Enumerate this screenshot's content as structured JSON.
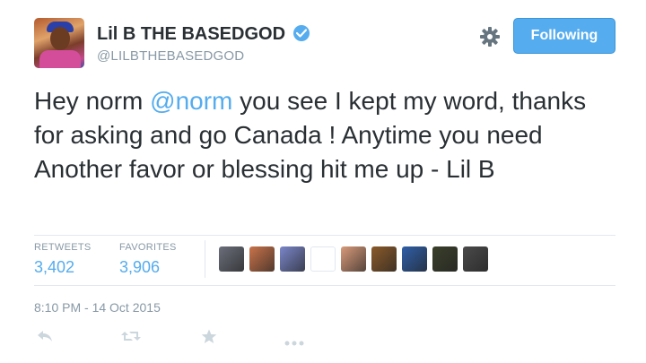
{
  "user": {
    "name": "Lil B THE BASEDGOD",
    "handle": "@LILBTHEBASEDGOD",
    "verified": true
  },
  "follow_button": {
    "label": "Following"
  },
  "tweet": {
    "text_before": "Hey norm ",
    "mention": "@norm",
    "text_after": " you see I kept my word, thanks for asking and go Canada ! Anytime you need Another favor or blessing hit me up - Lil B"
  },
  "stats": {
    "retweets_label": "RETWEETS",
    "retweets_value": "3,402",
    "favorites_label": "FAVORITES",
    "favorites_value": "3,906"
  },
  "favoriters": [
    {
      "color": "#6b6f7a"
    },
    {
      "color": "#c9734a"
    },
    {
      "color": "#7a86c9"
    },
    {
      "color": "#ffffff"
    },
    {
      "color": "#d89a7a"
    },
    {
      "color": "#8a5a2a"
    },
    {
      "color": "#2f5fa8"
    },
    {
      "color": "#3a3f2a"
    },
    {
      "color": "#4a4a4a"
    }
  ],
  "timestamp": "8:10 PM - 14 Oct 2015",
  "icons": {
    "verified": "verified-badge-icon",
    "settings": "gear-icon",
    "reply": "reply-icon",
    "retweet": "retweet-icon",
    "favorite": "star-icon",
    "more": "more-icon"
  },
  "colors": {
    "accent": "#55acee",
    "text": "#292f33",
    "muted": "#8899a6",
    "divider": "#e1e8ed"
  }
}
